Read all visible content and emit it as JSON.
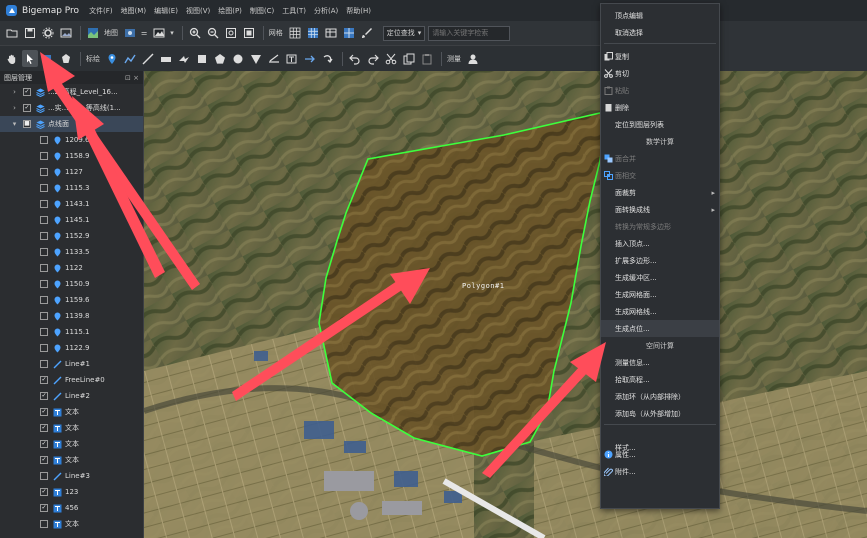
{
  "app": {
    "name": "Bigemap Pro"
  },
  "menubar": [
    "文件(F)",
    "地图(M)",
    "编辑(E)",
    "视图(V)",
    "绘图(P)",
    "制图(C)",
    "工具(T)",
    "分析(A)",
    "帮助(H)"
  ],
  "toolbar1": {
    "map_label": "地图",
    "grid_label": "网格",
    "locate_label": "定位查找",
    "search_placeholder": "请输入关键字检索"
  },
  "toolbar2": {
    "annotate_label": "标绘",
    "measure_label": "测量"
  },
  "layer_panel": {
    "title": "图层管理",
    "pin_glyph": "⊡",
    "close_glyph": "×",
    "groups": [
      {
        "label": "...2_高程_Level_16...",
        "expanded": false
      },
      {
        "label": "...实...文件_等高线(1...",
        "expanded": false
      },
      {
        "label": "点线面",
        "expanded": true,
        "selected": true
      }
    ],
    "items": [
      {
        "type": "point",
        "label": "1209.6",
        "checked": false
      },
      {
        "type": "point",
        "label": "1158.9",
        "checked": false
      },
      {
        "type": "point",
        "label": "1127",
        "checked": false
      },
      {
        "type": "point",
        "label": "1115.3",
        "checked": false
      },
      {
        "type": "point",
        "label": "1143.1",
        "checked": false
      },
      {
        "type": "point",
        "label": "1145.1",
        "checked": false
      },
      {
        "type": "point",
        "label": "1152.9",
        "checked": false
      },
      {
        "type": "point",
        "label": "1133.5",
        "checked": false
      },
      {
        "type": "point",
        "label": "1122",
        "checked": false
      },
      {
        "type": "point",
        "label": "1150.9",
        "checked": false
      },
      {
        "type": "point",
        "label": "1159.6",
        "checked": false
      },
      {
        "type": "point",
        "label": "1139.8",
        "checked": false
      },
      {
        "type": "point",
        "label": "1115.1",
        "checked": false
      },
      {
        "type": "point",
        "label": "1122.9",
        "checked": false
      },
      {
        "type": "line",
        "label": "Line#1",
        "checked": false
      },
      {
        "type": "line",
        "label": "FreeLine#0",
        "checked": true
      },
      {
        "type": "line",
        "label": "Line#2",
        "checked": true
      },
      {
        "type": "text",
        "label": "文本",
        "checked": true
      },
      {
        "type": "text",
        "label": "文本",
        "checked": true
      },
      {
        "type": "text",
        "label": "文本",
        "checked": true
      },
      {
        "type": "text",
        "label": "文本",
        "checked": true
      },
      {
        "type": "line",
        "label": "Line#3",
        "checked": false
      },
      {
        "type": "text",
        "label": "123",
        "checked": true
      },
      {
        "type": "text",
        "label": "456",
        "checked": true
      },
      {
        "type": "text",
        "label": "文本",
        "checked": false
      }
    ]
  },
  "map": {
    "polygon_label": "Polygon#1"
  },
  "context_menu": [
    {
      "label": "顶点编辑",
      "state": "normal"
    },
    {
      "label": "取消选择",
      "state": "normal",
      "icon": "none"
    },
    {
      "sep": true
    },
    {
      "label": "复制",
      "state": "normal",
      "icon": "copy-icon"
    },
    {
      "label": "剪切",
      "state": "normal",
      "icon": "scissors-icon"
    },
    {
      "label": "粘贴",
      "state": "disabled",
      "icon": "paste-icon"
    },
    {
      "label": "删除",
      "state": "normal",
      "icon": "delete-icon"
    },
    {
      "label": "定位到图层列表",
      "state": "normal"
    },
    {
      "section": "数学计算"
    },
    {
      "label": "面合并",
      "state": "disabled",
      "icon": "merge-icon"
    },
    {
      "label": "面相交",
      "state": "disabled",
      "icon": "intersect-icon"
    },
    {
      "label": "面裁剪",
      "state": "normal",
      "submenu": true
    },
    {
      "label": "面转换成线",
      "state": "normal",
      "submenu": true
    },
    {
      "label": "转换为常规多边形",
      "state": "disabled"
    },
    {
      "label": "插入顶点...",
      "state": "normal"
    },
    {
      "label": "扩展多边形...",
      "state": "normal"
    },
    {
      "label": "生成缓冲区...",
      "state": "normal"
    },
    {
      "label": "生成网格面...",
      "state": "normal"
    },
    {
      "label": "生成网格线...",
      "state": "normal"
    },
    {
      "label": "生成点位...",
      "state": "highlighted"
    },
    {
      "section": "空间计算"
    },
    {
      "label": "测量信息...",
      "state": "normal"
    },
    {
      "label": "拾取高程...",
      "state": "normal"
    },
    {
      "label": "添加环（从内部排除）",
      "state": "normal"
    },
    {
      "label": "添加岛（从外部增加）",
      "state": "normal"
    },
    {
      "sep": true
    },
    {
      "label": "样式...",
      "state": "normal"
    },
    {
      "label": "属性...",
      "state": "normal",
      "icon": "info-icon"
    },
    {
      "label": "附件...",
      "state": "normal",
      "icon": "attachment-icon"
    }
  ],
  "colors": {
    "accent": "#2f7fd8",
    "polygon_stroke": "#3dff3d",
    "arrow": "#ff4d5a"
  }
}
